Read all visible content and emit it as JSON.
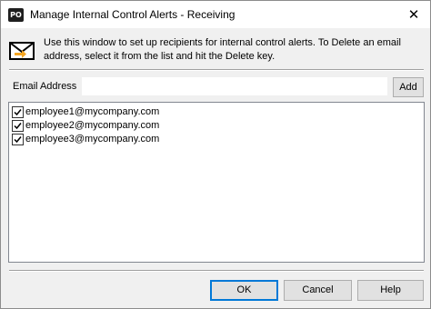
{
  "window": {
    "title": "Manage Internal Control Alerts - Receiving",
    "app_icon_text": "PO"
  },
  "info": {
    "icon": "envelope-icon",
    "text": "Use this window to set up recipients for internal control alerts. To Delete an email address, select it from the list and hit the Delete key."
  },
  "email": {
    "label": "Email Address",
    "value": "",
    "add_label": "Add"
  },
  "recipients": [
    {
      "email": "employee1@mycompany.com",
      "checked": true
    },
    {
      "email": "employee2@mycompany.com",
      "checked": true
    },
    {
      "email": "employee3@mycompany.com",
      "checked": true
    }
  ],
  "buttons": {
    "ok": "OK",
    "cancel": "Cancel",
    "help": "Help"
  },
  "colors": {
    "focus_border": "#0078d7",
    "envelope_fill": "#ffffff",
    "envelope_stroke": "#000000",
    "arrow": "#f5a623"
  }
}
